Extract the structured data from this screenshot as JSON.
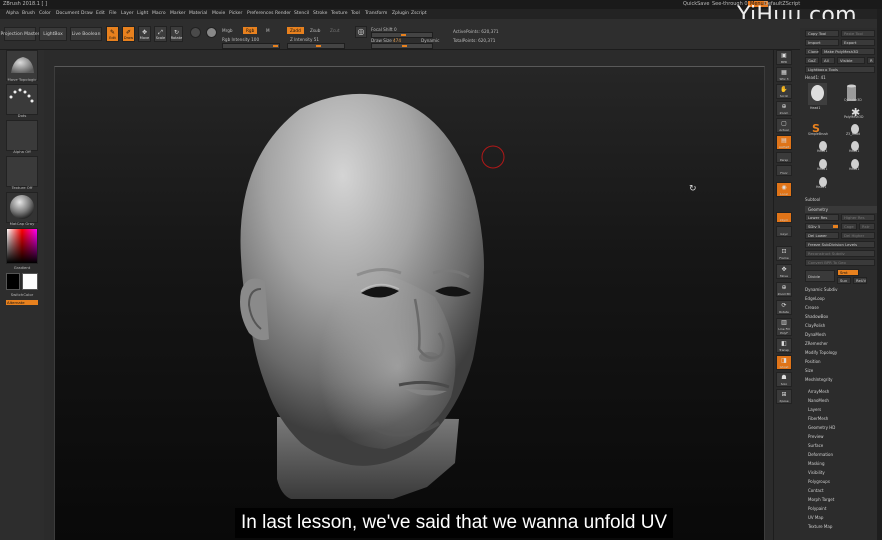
{
  "window": {
    "title": "ZBrush 2018.1 [ ]",
    "quicksave": "QuickSave",
    "see_through": "See-through 0",
    "menus_label": "Menus",
    "default_script": "DefaultZScript"
  },
  "watermark": "YiHuu.com",
  "menubar": [
    "Alpha",
    "Brush",
    "Color",
    "Document",
    "Draw",
    "Edit",
    "File",
    "Layer",
    "Light",
    "Macro",
    "Marker",
    "Material",
    "Movie",
    "Picker",
    "Preferences",
    "Render",
    "Stencil",
    "Stroke",
    "Texture",
    "Tool",
    "Transform",
    "Zplugin",
    "Zscript"
  ],
  "toolbar": {
    "projection_master": "Projection Master",
    "lightbox": "LightBox",
    "live_boolean": "Live Boolean",
    "edit": "Edit",
    "draw": "Draw",
    "move": "Move",
    "scale": "Scale",
    "rotate": "Rotate",
    "mrgb": "Mrgb",
    "rgb": "Rgb",
    "m": "M",
    "zadd": "Zadd",
    "zsub": "Zsub",
    "zcut": "Zcut",
    "rgb_intensity": "Rgb Intensity 100",
    "z_intensity": "Z Intensity 51",
    "focal_shift": "Focal Shift 0",
    "draw_size": "Draw Size",
    "draw_size_value": "474",
    "dynamic": "Dynamic",
    "active_points": "ActivePoints: 620,371",
    "total_points": "TotalPoints: 620,371"
  },
  "left_shelf": {
    "brush_label": "Move Topologic",
    "stroke_label": "Dots",
    "alpha_label": "Alpha Off",
    "texture_label": "Texture Off",
    "material_label": "MatCap Gray",
    "gradient_label": "Gradient",
    "switch_color": "SwitchColor",
    "alternate": "Alternate"
  },
  "right_shelf": [
    "BPR",
    "SPix 3",
    "Scroll",
    "Zoom",
    "Actual",
    "AAHalf",
    "Persp",
    "Floor",
    "Local",
    "LSym",
    "Gxyz",
    "Frame",
    "Move",
    "Zoom3D",
    "Rotate",
    "Line Fill PolyF",
    "Transp",
    "Ghost",
    "Solo",
    "Xpose"
  ],
  "right_panel": {
    "header": [
      "Copy Tool",
      "Paste Tool",
      "Import",
      "Export",
      "Clone",
      "Make PolyMesh3D",
      "GoZ",
      "All",
      "Visible",
      "R"
    ],
    "lightbox_tools": "Lightbox ▸ Tools",
    "tool_name": "Head1: 41",
    "tools": [
      "Head1",
      "Cylinder3D",
      "PolyMesh3D",
      "SimpleBrush",
      "Z3_Head",
      "Head1",
      "Head1",
      "Head1",
      "Head1",
      "Head1"
    ],
    "subtool": "Subtool",
    "geometry": "Geometry",
    "lower_res": "Lower Res",
    "higher_res": "Higher Res",
    "sdiv": "SDiv 5",
    "cage": "Cage",
    "rstr": "Rstr",
    "del_lower": "Del Lower",
    "del_higher": "Del Higher",
    "freeze_subdiv": "Freeze SubDivision Levels",
    "reconstruct_subdiv": "Reconstruct Subdiv",
    "convert_bpr": "Convert BPR To Geo",
    "divide": "Divide",
    "smt": "Smt",
    "suv": "Suv",
    "relpf": "ReUV",
    "sections": [
      "Dynamic Subdiv",
      "EdgeLoop",
      "Crease",
      "ShadowBox",
      "ClayPolish",
      "DynaMesh",
      "ZRemesher",
      "Modify Topology",
      "Position",
      "Size",
      "MeshIntegrity"
    ],
    "subpalettes": [
      "ArrayMesh",
      "NanoMesh",
      "Layers",
      "FiberMesh",
      "Geometry HD",
      "Preview",
      "Surface",
      "Deformation",
      "Masking",
      "Visibility",
      "Polygroups",
      "Contact",
      "Morph Target",
      "Polypaint",
      "UV Map",
      "Texture Map"
    ]
  },
  "caption": "In last lesson, we've said that we wanna unfold UV",
  "colors": {
    "accent": "#e8811e",
    "panel": "#2c2c2c",
    "viewport_dark": "#0b0b0b"
  }
}
